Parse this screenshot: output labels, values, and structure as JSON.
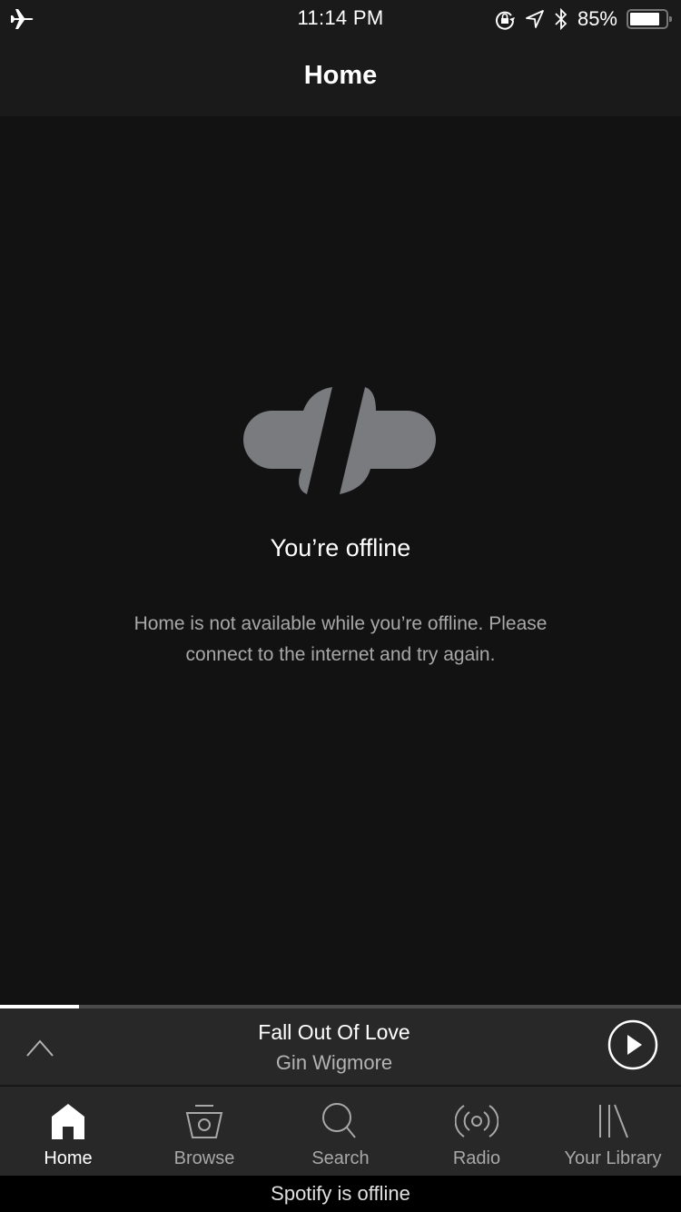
{
  "status_bar": {
    "time": "11:14 PM",
    "battery_percent_label": "85%",
    "battery_level": 0.85,
    "icons": [
      "airplane-icon",
      "orientation-lock-icon",
      "location-icon",
      "bluetooth-icon",
      "battery-icon"
    ]
  },
  "header": {
    "title": "Home"
  },
  "main": {
    "icon": "offline-plug-icon",
    "title": "You’re offline",
    "message": "Home is not available while you’re offline. Please connect to the internet and try again."
  },
  "now_playing": {
    "track": "Fall Out Of Love",
    "artist": "Gin Wigmore",
    "progress": 0.116,
    "expand_icon": "chevron-up-icon",
    "play_icon": "play-icon"
  },
  "tabs": [
    {
      "label": "Home",
      "icon": "home-icon",
      "active": true
    },
    {
      "label": "Browse",
      "icon": "browse-icon",
      "active": false
    },
    {
      "label": "Search",
      "icon": "search-icon",
      "active": false
    },
    {
      "label": "Radio",
      "icon": "radio-icon",
      "active": false
    },
    {
      "label": "Your Library",
      "icon": "library-icon",
      "active": false
    }
  ],
  "offline_banner": "Spotify is offline",
  "colors": {
    "background": "#121212",
    "header": "#1a1a1a",
    "bar": "#282828",
    "icon_gray": "#7a7b7e",
    "text_secondary": "#a8a8a8"
  }
}
